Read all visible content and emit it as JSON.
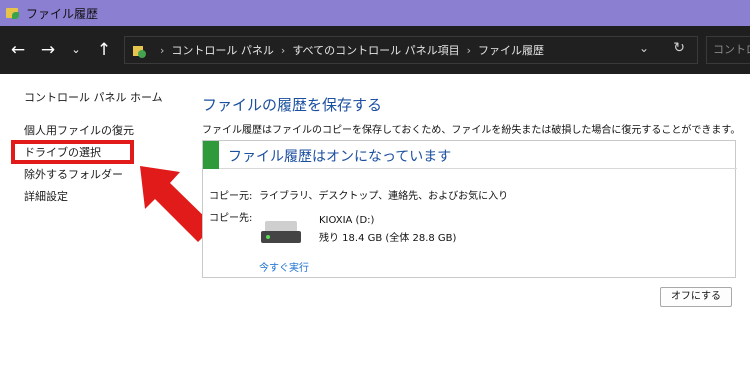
{
  "window": {
    "title": "ファイル履歴"
  },
  "nav": {
    "back_icon": "←",
    "forward_icon": "→",
    "history_icon": "⌄",
    "up_icon": "↑",
    "breadcrumbs": [
      "コントロール パネル",
      "すべてのコントロール パネル項目",
      "ファイル履歴"
    ],
    "sep_glyph": "›",
    "dropdown_icon": "⌄",
    "refresh_icon": "↻",
    "search_placeholder": "コントロール"
  },
  "sidebar": {
    "home": "コントロール パネル ホーム",
    "restore": "個人用ファイルの復元",
    "select_drive": "ドライブの選択",
    "exclude": "除外するフォルダー",
    "advanced": "詳細設定"
  },
  "main": {
    "title": "ファイルの履歴を保存する",
    "description": "ファイル履歴はファイルのコピーを保存しておくため、ファイルを紛失または破損した場合に復元することができます。",
    "status": "ファイル履歴はオンになっています",
    "copy_from_label": "コピー元:",
    "copy_from_value": "ライブラリ、デスクトップ、連絡先、およびお気に入り",
    "copy_to_label": "コピー先:",
    "drive_name": "KIOXIA (D:)",
    "drive_space": "残り 18.4 GB (全体 28.8 GB)",
    "run_now": "今すぐ実行",
    "off_button": "オフにする"
  },
  "colors": {
    "title_bar": "#8b7fd1",
    "nav_bar": "#1f1f1f",
    "link_blue": "#1b4fa0",
    "status_green": "#2f9a3a",
    "annotation_red": "#e11a1a"
  }
}
